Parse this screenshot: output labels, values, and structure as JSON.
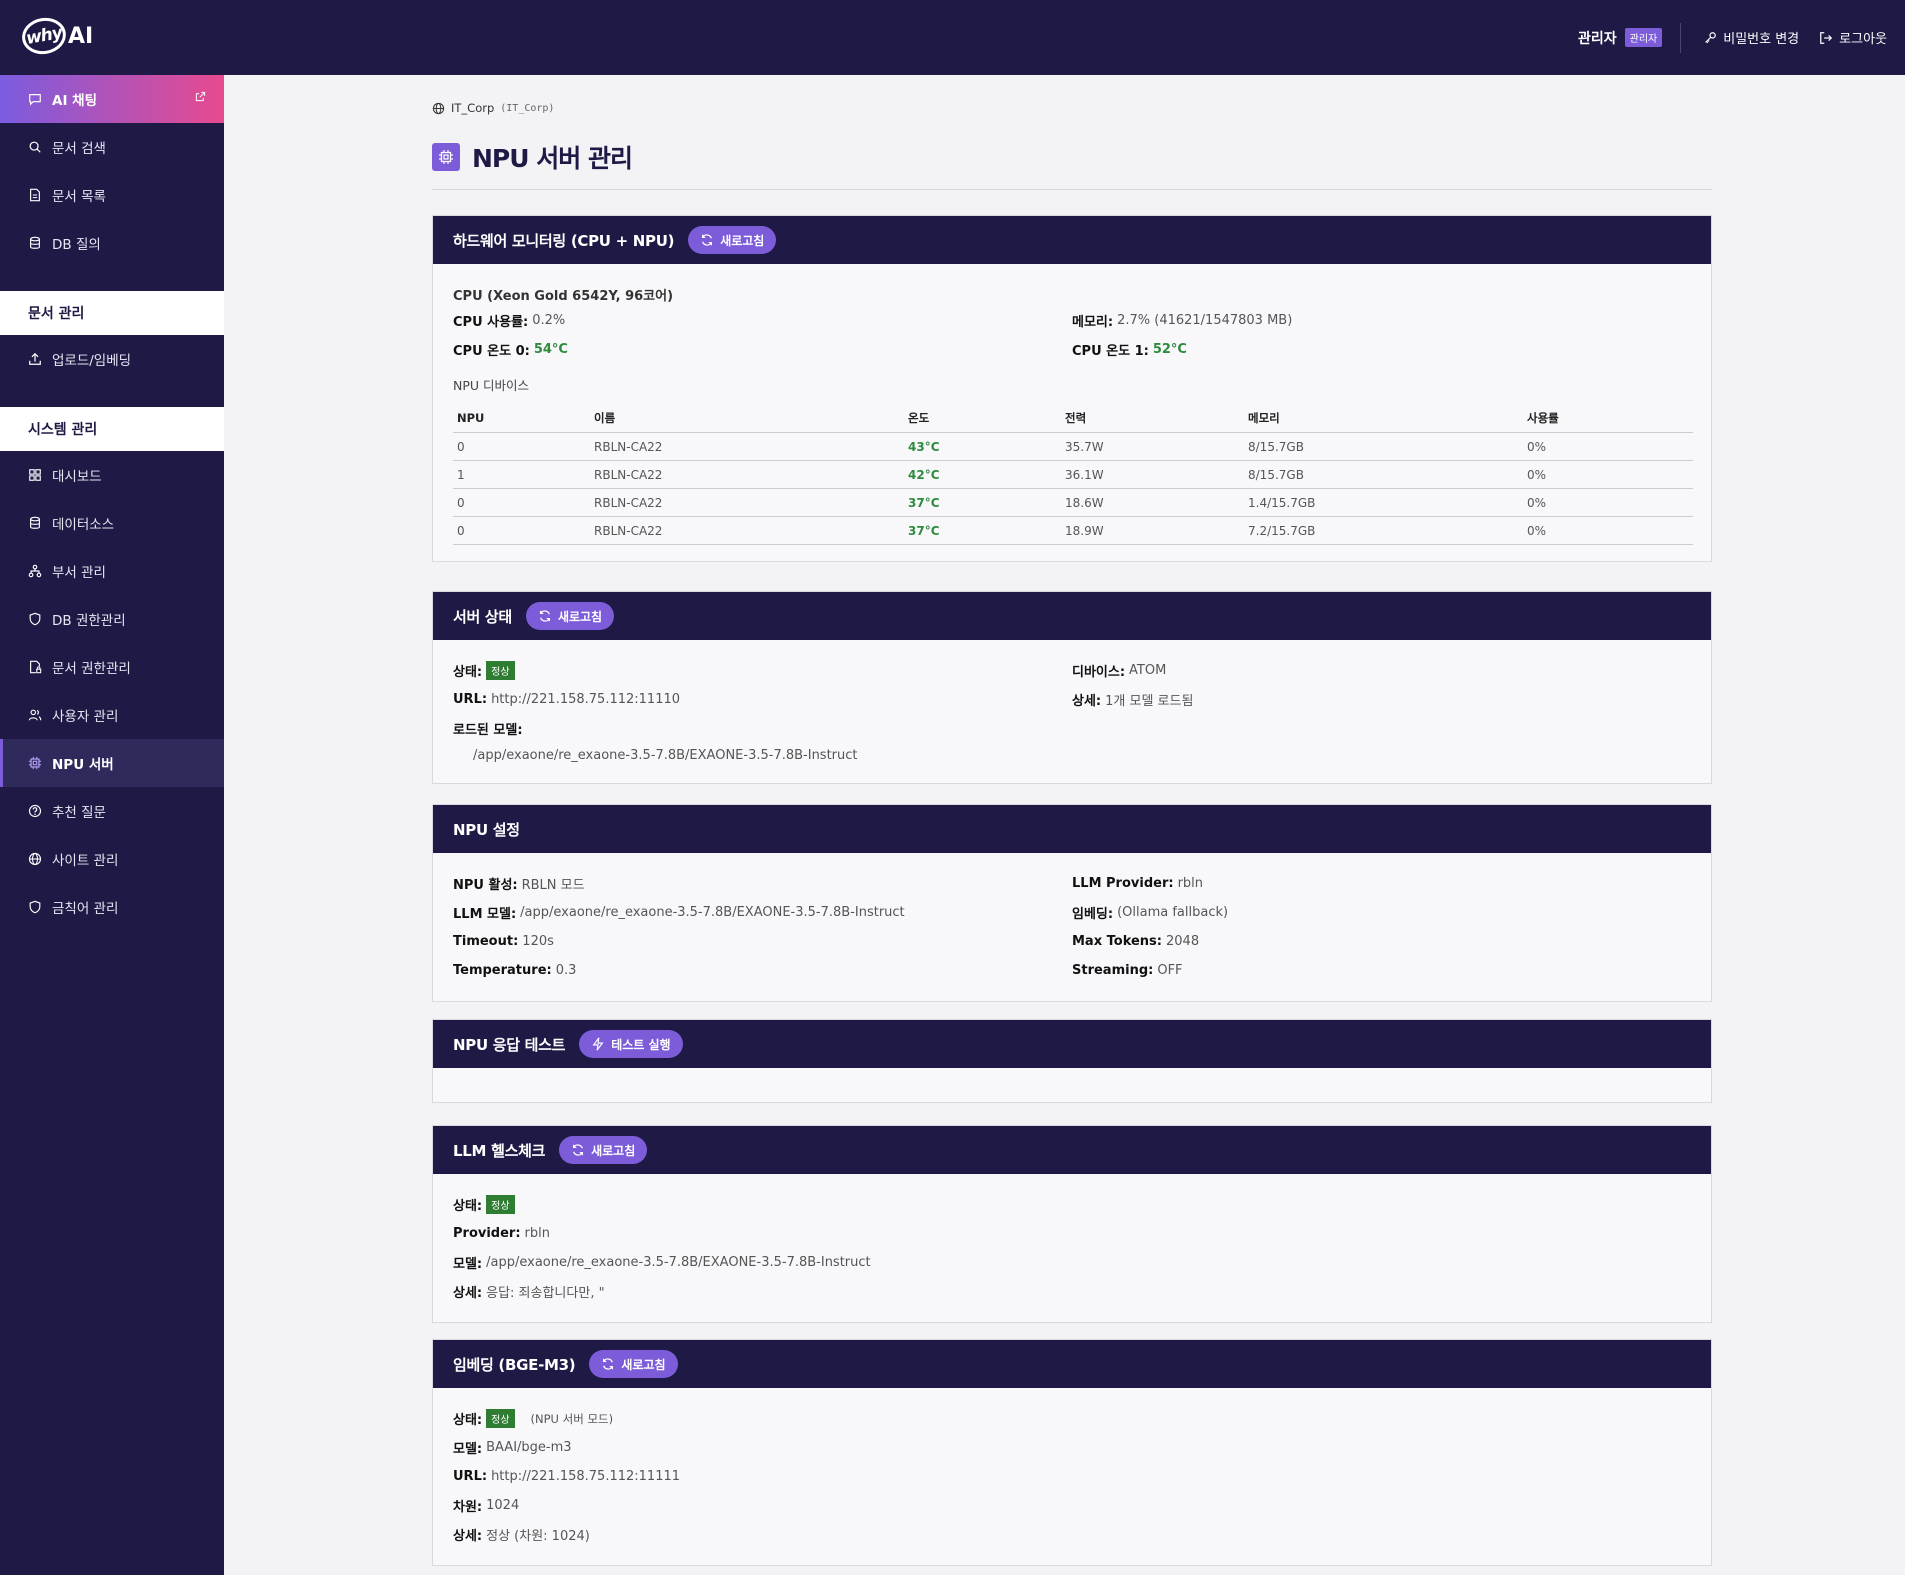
{
  "header": {
    "logo_mark": "why",
    "logo_text": "AI",
    "user_name": "관리자",
    "role_badge": "관리자",
    "change_password": "비밀번호 변경",
    "logout": "로그아웃"
  },
  "sidebar": {
    "ai_chat": "AI 채팅",
    "items_top": [
      "문서 검색",
      "문서 목록",
      "DB 질의"
    ],
    "section_docs": "문서 관리",
    "upload": "업로드/임베딩",
    "section_system": "시스템 관리",
    "items_system": [
      "대시보드",
      "데이터소스",
      "부서 관리",
      "DB 권한관리",
      "문서 권한관리",
      "사용자 관리",
      "NPU 서버",
      "추천 질문",
      "사이트 관리",
      "금칙어 관리"
    ]
  },
  "breadcrumb": {
    "site": "IT_Corp",
    "code": "(IT_Corp)"
  },
  "page_title": "NPU 서버 관리",
  "hardware": {
    "title": "하드웨어 모니터링 (CPU + NPU)",
    "refresh": "새로고침",
    "cpu_model": "CPU (Xeon Gold 6542Y, 96코어)",
    "cpu_usage_label": "CPU 사용률:",
    "cpu_usage": "0.2%",
    "memory_label": "메모리:",
    "memory": "2.7% (41621/1547803 MB)",
    "cpu_temp0_label": "CPU 온도 0:",
    "cpu_temp0": "54°C",
    "cpu_temp1_label": "CPU 온도 1:",
    "cpu_temp1": "52°C",
    "npu_devices_label": "NPU 디바이스",
    "table_headers": [
      "NPU",
      "이름",
      "온도",
      "전력",
      "메모리",
      "사용률"
    ],
    "rows": [
      [
        "0",
        "RBLN-CA22",
        "43°C",
        "35.7W",
        "8/15.7GB",
        "0%"
      ],
      [
        "1",
        "RBLN-CA22",
        "42°C",
        "36.1W",
        "8/15.7GB",
        "0%"
      ],
      [
        "0",
        "RBLN-CA22",
        "37°C",
        "18.6W",
        "1.4/15.7GB",
        "0%"
      ],
      [
        "0",
        "RBLN-CA22",
        "37°C",
        "18.9W",
        "7.2/15.7GB",
        "0%"
      ]
    ]
  },
  "server_status": {
    "title": "서버 상태",
    "refresh": "새로고침",
    "status_label": "상태:",
    "status": "정상",
    "device_label": "디바이스:",
    "device": "ATOM",
    "url_label": "URL:",
    "url": "http://221.158.75.112:11110",
    "detail_label": "상세:",
    "detail": "1개 모델 로드됨",
    "loaded_models_label": "로드된 모델:",
    "loaded_model": "/app/exaone/re_exaone-3.5-7.8B/EXAONE-3.5-7.8B-Instruct"
  },
  "npu_settings": {
    "title": "NPU 설정",
    "npu_active_label": "NPU 활성:",
    "npu_active": "RBLN 모드",
    "llm_provider_label": "LLM Provider:",
    "llm_provider": "rbln",
    "llm_model_label": "LLM 모델:",
    "llm_model": "/app/exaone/re_exaone-3.5-7.8B/EXAONE-3.5-7.8B-Instruct",
    "embedding_label": "임베딩:",
    "embedding": "(Ollama fallback)",
    "timeout_label": "Timeout:",
    "timeout": "120s",
    "max_tokens_label": "Max Tokens:",
    "max_tokens": "2048",
    "temperature_label": "Temperature:",
    "temperature": "0.3",
    "streaming_label": "Streaming:",
    "streaming": "OFF"
  },
  "npu_test": {
    "title": "NPU 응답 테스트",
    "run": "테스트 실행"
  },
  "llm_health": {
    "title": "LLM 헬스체크",
    "refresh": "새로고침",
    "status_label": "상태:",
    "status": "정상",
    "provider_label": "Provider:",
    "provider": "rbln",
    "model_label": "모델:",
    "model": "/app/exaone/re_exaone-3.5-7.8B/EXAONE-3.5-7.8B-Instruct",
    "detail_label": "상세:",
    "detail": "응답: 죄송합니다만, \""
  },
  "embedding": {
    "title": "임베딩 (BGE-M3)",
    "refresh": "새로고침",
    "status_label": "상태:",
    "status": "정상",
    "mode": "(NPU 서버 모드)",
    "model_label": "모델:",
    "model": "BAAI/bge-m3",
    "url_label": "URL:",
    "url": "http://221.158.75.112:11111",
    "dim_label": "차원:",
    "dim": "1024",
    "detail_label": "상세:",
    "detail": "정상 (차원: 1024)"
  },
  "colors": {
    "navy": "#1e1a45",
    "accent": "#7c5cd8",
    "ok_green": "#2e7d32"
  }
}
